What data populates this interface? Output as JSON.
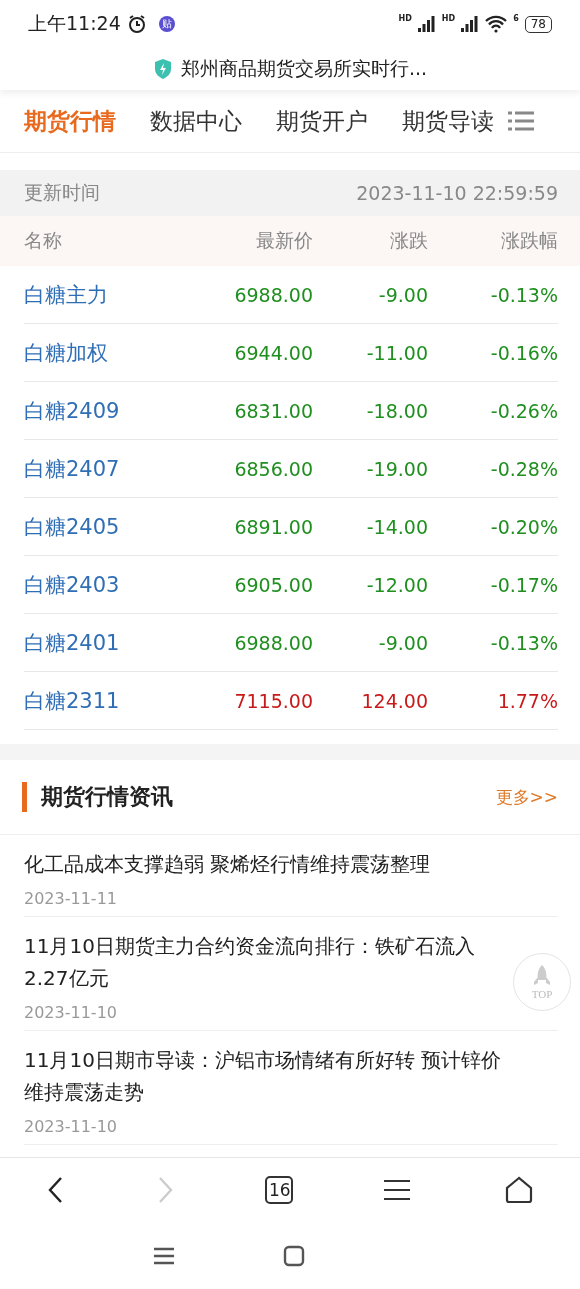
{
  "status_bar": {
    "time": "上午11:24",
    "app_badge": "贴",
    "signals": [
      "HD",
      "HD"
    ],
    "wifi_label": "6",
    "battery": "78"
  },
  "url_bar": {
    "title": "郑州商品期货交易所实时行..."
  },
  "tabs": [
    {
      "label": "期货行情",
      "selected": true
    },
    {
      "label": "数据中心",
      "selected": false
    },
    {
      "label": "期货开户",
      "selected": false
    },
    {
      "label": "期货导读",
      "selected": false
    }
  ],
  "update": {
    "label": "更新时间",
    "time": "2023-11-10 22:59:59"
  },
  "table": {
    "columns": [
      "名称",
      "最新价",
      "涨跌",
      "涨跌幅"
    ],
    "rows": [
      {
        "name": "白糖主力",
        "price": "6988.00",
        "change": "-9.00",
        "pct": "-0.13%",
        "color": "#1f8f1f"
      },
      {
        "name": "白糖加权",
        "price": "6944.00",
        "change": "-11.00",
        "pct": "-0.16%",
        "color": "#1f8f1f"
      },
      {
        "name": "白糖2409",
        "price": "6831.00",
        "change": "-18.00",
        "pct": "-0.26%",
        "color": "#1f8f1f"
      },
      {
        "name": "白糖2407",
        "price": "6856.00",
        "change": "-19.00",
        "pct": "-0.28%",
        "color": "#1f8f1f"
      },
      {
        "name": "白糖2405",
        "price": "6891.00",
        "change": "-14.00",
        "pct": "-0.20%",
        "color": "#1f8f1f"
      },
      {
        "name": "白糖2403",
        "price": "6905.00",
        "change": "-12.00",
        "pct": "-0.17%",
        "color": "#1f8f1f"
      },
      {
        "name": "白糖2401",
        "price": "6988.00",
        "change": "-9.00",
        "pct": "-0.13%",
        "color": "#1f8f1f"
      },
      {
        "name": "白糖2311",
        "price": "7115.00",
        "change": "124.00",
        "pct": "1.77%",
        "color": "#c81a1a"
      }
    ]
  },
  "news": {
    "title": "期货行情资讯",
    "more": "更多>>",
    "items": [
      {
        "headline": "化工品成本支撑趋弱 聚烯烃行情维持震荡整理",
        "date": "2023-11-11"
      },
      {
        "headline": "11月10日期货主力合约资金流向排行：铁矿石流入2.27亿元",
        "date": "2023-11-10"
      },
      {
        "headline": "11月10日期市导读：沪铝市场情绪有所好转 预计锌价维持震荡走势",
        "date": "2023-11-10"
      }
    ]
  },
  "top_button": {
    "label": "TOP"
  },
  "browser_bar": {
    "tab_count": "16"
  }
}
